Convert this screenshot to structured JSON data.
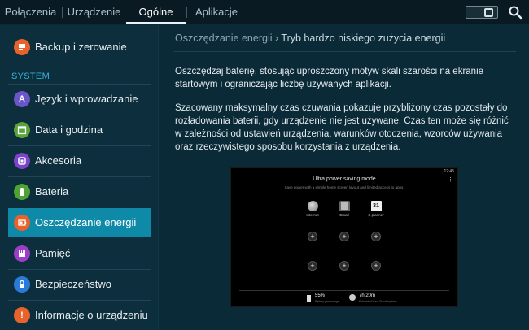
{
  "tabs": [
    {
      "label": "Połączenia"
    },
    {
      "label": "Urządzenie"
    },
    {
      "label": "Ogólne"
    },
    {
      "label": "Aplikacje"
    }
  ],
  "sidebar": {
    "section_label": "SYSTEM",
    "items": [
      {
        "label": "Backup i zerowanie",
        "icon": "backup-icon",
        "color": "#e8622b"
      },
      {
        "label": "Język i wprowadzanie",
        "icon": "language-icon",
        "color": "#6a55c9"
      },
      {
        "label": "Data i godzina",
        "icon": "calendar-icon",
        "color": "#5aa33a"
      },
      {
        "label": "Akcesoria",
        "icon": "accessories-icon",
        "color": "#7c45c8"
      },
      {
        "label": "Bateria",
        "icon": "battery-icon",
        "color": "#4fa234"
      },
      {
        "label": "Oszczędzanie energii",
        "icon": "power-saving-icon",
        "color": "#e8622b"
      },
      {
        "label": "Pamięć",
        "icon": "storage-icon",
        "color": "#9b3fc7"
      },
      {
        "label": "Bezpieczeństwo",
        "icon": "security-icon",
        "color": "#2a7bd8"
      },
      {
        "label": "Informacje o urządzeniu",
        "icon": "info-icon",
        "color": "#e8622b"
      }
    ]
  },
  "breadcrumb": {
    "parent": "Oszczędzanie energii",
    "separator": "›",
    "current": "Tryb bardzo niskiego zużycia energii"
  },
  "content": {
    "para1": "Oszczędzaj baterię, stosując uproszczony motyw skali szarości na ekranie startowym i ograniczając liczbę używanych aplikacji.",
    "para2": "Szacowany maksymalny czas czuwania pokazuje przybliżony czas pozostały do rozładowania baterii, gdy urządzenie nie jest używane. Czas ten może się różnić w zależności od ustawień urządzenia, warunków otoczenia, wzorców używania oraz rzeczywistego sposobu korzystania z urządzenia."
  },
  "preview": {
    "status_time": "12:45",
    "title": "Ultra power saving mode",
    "subtitle": "Save power with a simple home screen layout and limited access to apps.",
    "apps": [
      {
        "name": "Internet"
      },
      {
        "name": "Email"
      },
      {
        "name": "S planner",
        "day": "31"
      }
    ],
    "battery_percent": "55%",
    "battery_label": "Battery percentage",
    "standby_time": "7h 20m",
    "standby_label": "Estimated Max. Stand-by time"
  },
  "colors": {
    "accent": "#0e8aa8",
    "section": "#2fb7d8"
  }
}
